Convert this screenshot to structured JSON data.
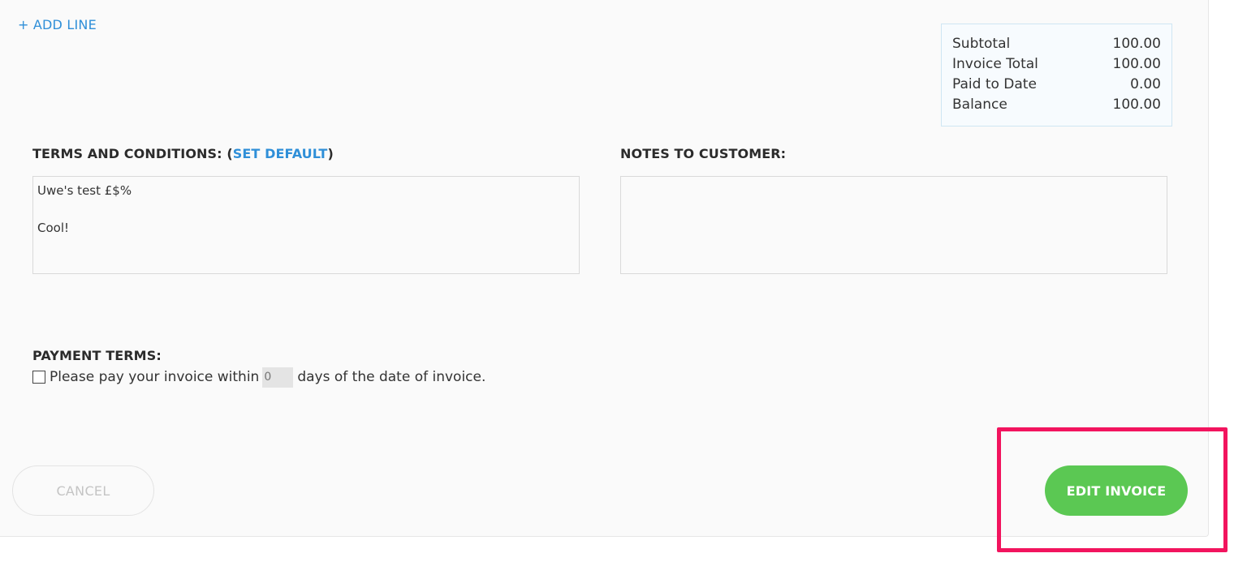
{
  "add_line": {
    "label": "+ ADD LINE"
  },
  "totals": {
    "rows": [
      {
        "label": "Subtotal",
        "value": "100.00"
      },
      {
        "label": "Invoice Total",
        "value": "100.00"
      },
      {
        "label": "Paid to Date",
        "value": "0.00"
      },
      {
        "label": "Balance",
        "value": "100.00"
      }
    ]
  },
  "terms": {
    "label_prefix": "TERMS AND CONDITIONS: (",
    "set_default": "SET DEFAULT",
    "label_suffix": ")",
    "lines": [
      "Uwe's test £$%",
      "",
      "Cool!"
    ]
  },
  "notes": {
    "label": "NOTES TO CUSTOMER:",
    "value": ""
  },
  "payment_terms": {
    "label": "PAYMENT TERMS:",
    "checked": false,
    "text_before": "Please pay your invoice within",
    "days_placeholder": "0",
    "text_after": "days of the date of invoice."
  },
  "actions": {
    "cancel_label": "CANCEL",
    "edit_label": "EDIT INVOICE"
  },
  "colors": {
    "accent_link": "#2f8fd8",
    "primary_button": "#5bc853",
    "highlight": "#f2145e"
  }
}
